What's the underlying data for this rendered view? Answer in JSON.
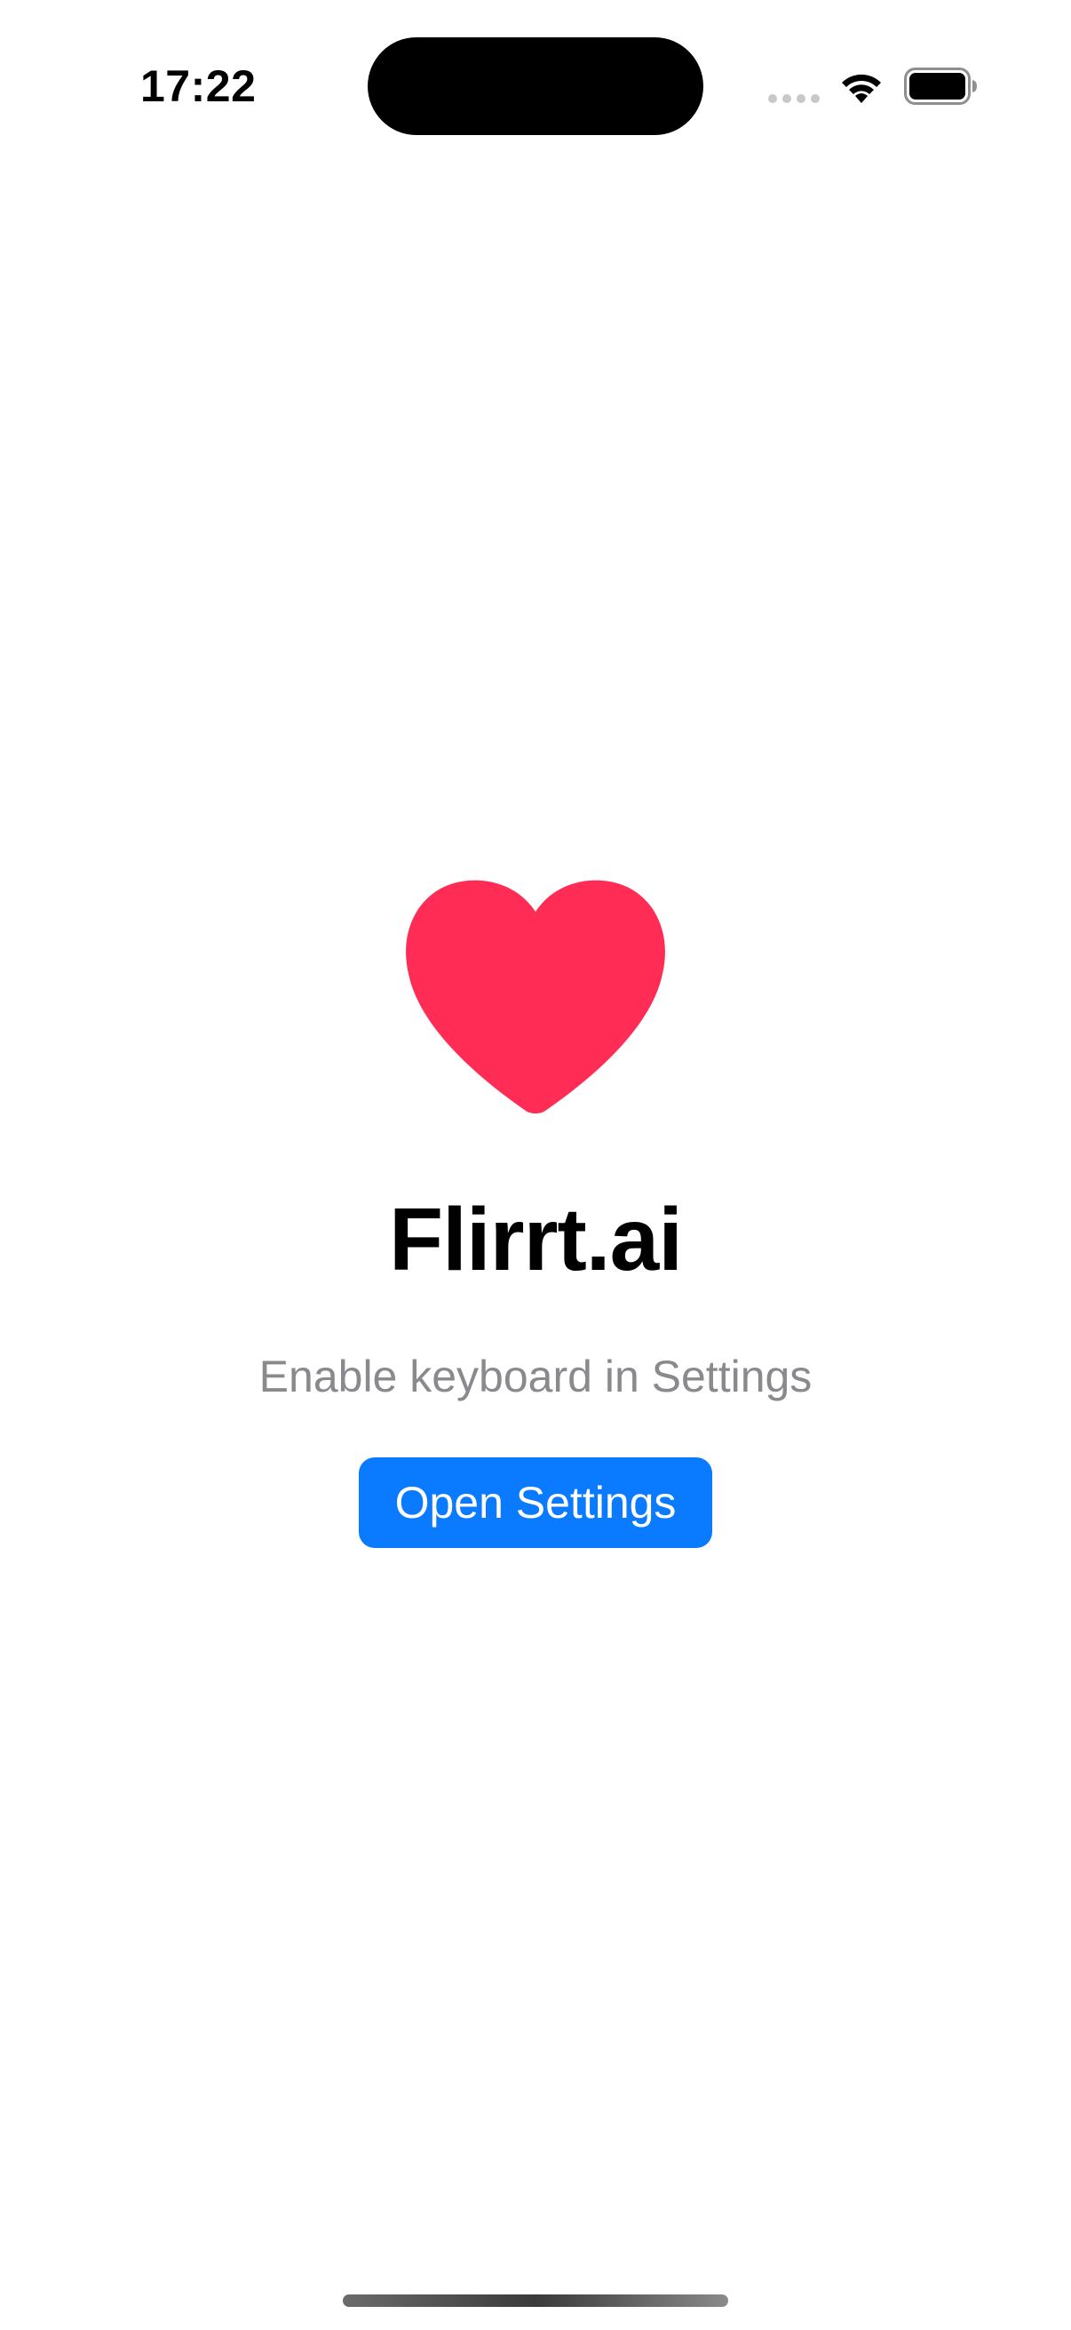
{
  "status_bar": {
    "time": "17:22"
  },
  "icons": {
    "signal": "cellular-signal-dots-icon",
    "wifi": "wifi-icon",
    "battery": "battery-icon",
    "hero": "heart-icon"
  },
  "main": {
    "title": "Flirrt.ai",
    "subtitle": "Enable keyboard in Settings",
    "open_settings_label": "Open Settings"
  },
  "colors": {
    "heart": "#ff2d55",
    "accent": "#0a7aff",
    "subtitle_text": "#8a8a8e",
    "background": "#ffffff"
  }
}
